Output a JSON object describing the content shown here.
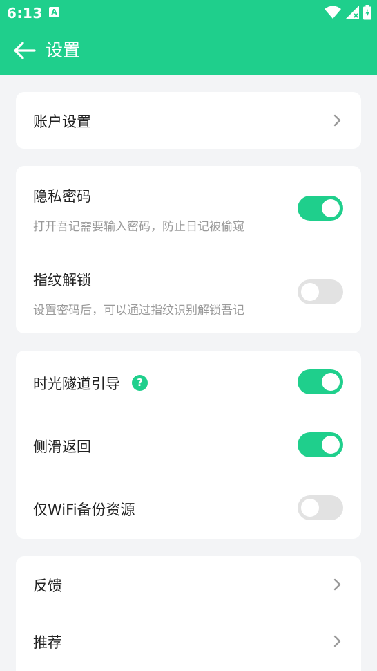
{
  "status_bar": {
    "time": "6:13",
    "notification_icon": "A",
    "icons": [
      "wifi-icon",
      "signal-icon",
      "battery-icon"
    ]
  },
  "app_bar": {
    "title": "设置",
    "back_icon": "arrow-left-icon"
  },
  "colors": {
    "accent": "#1fcf8c",
    "background": "#f3f4f6",
    "card": "#ffffff",
    "toggle_off": "#e2e2e2",
    "secondary_text": "#9a9a9a"
  },
  "sections": {
    "account": {
      "label": "账户设置"
    },
    "privacy_password": {
      "label": "隐私密码",
      "desc": "打开吾记需要输入密码，防止日记被偷窥",
      "enabled": true
    },
    "fingerprint": {
      "label": "指纹解锁",
      "desc": "设置密码后，可以通过指纹识别解锁吾记",
      "enabled": false
    },
    "time_tunnel": {
      "label": "时光隧道引导",
      "help": "?",
      "enabled": true
    },
    "swipe_back": {
      "label": "侧滑返回",
      "enabled": true
    },
    "wifi_backup": {
      "label": "仅WiFi备份资源",
      "enabled": false
    },
    "feedback": {
      "label": "反馈"
    },
    "recommend": {
      "label": "推荐"
    }
  }
}
